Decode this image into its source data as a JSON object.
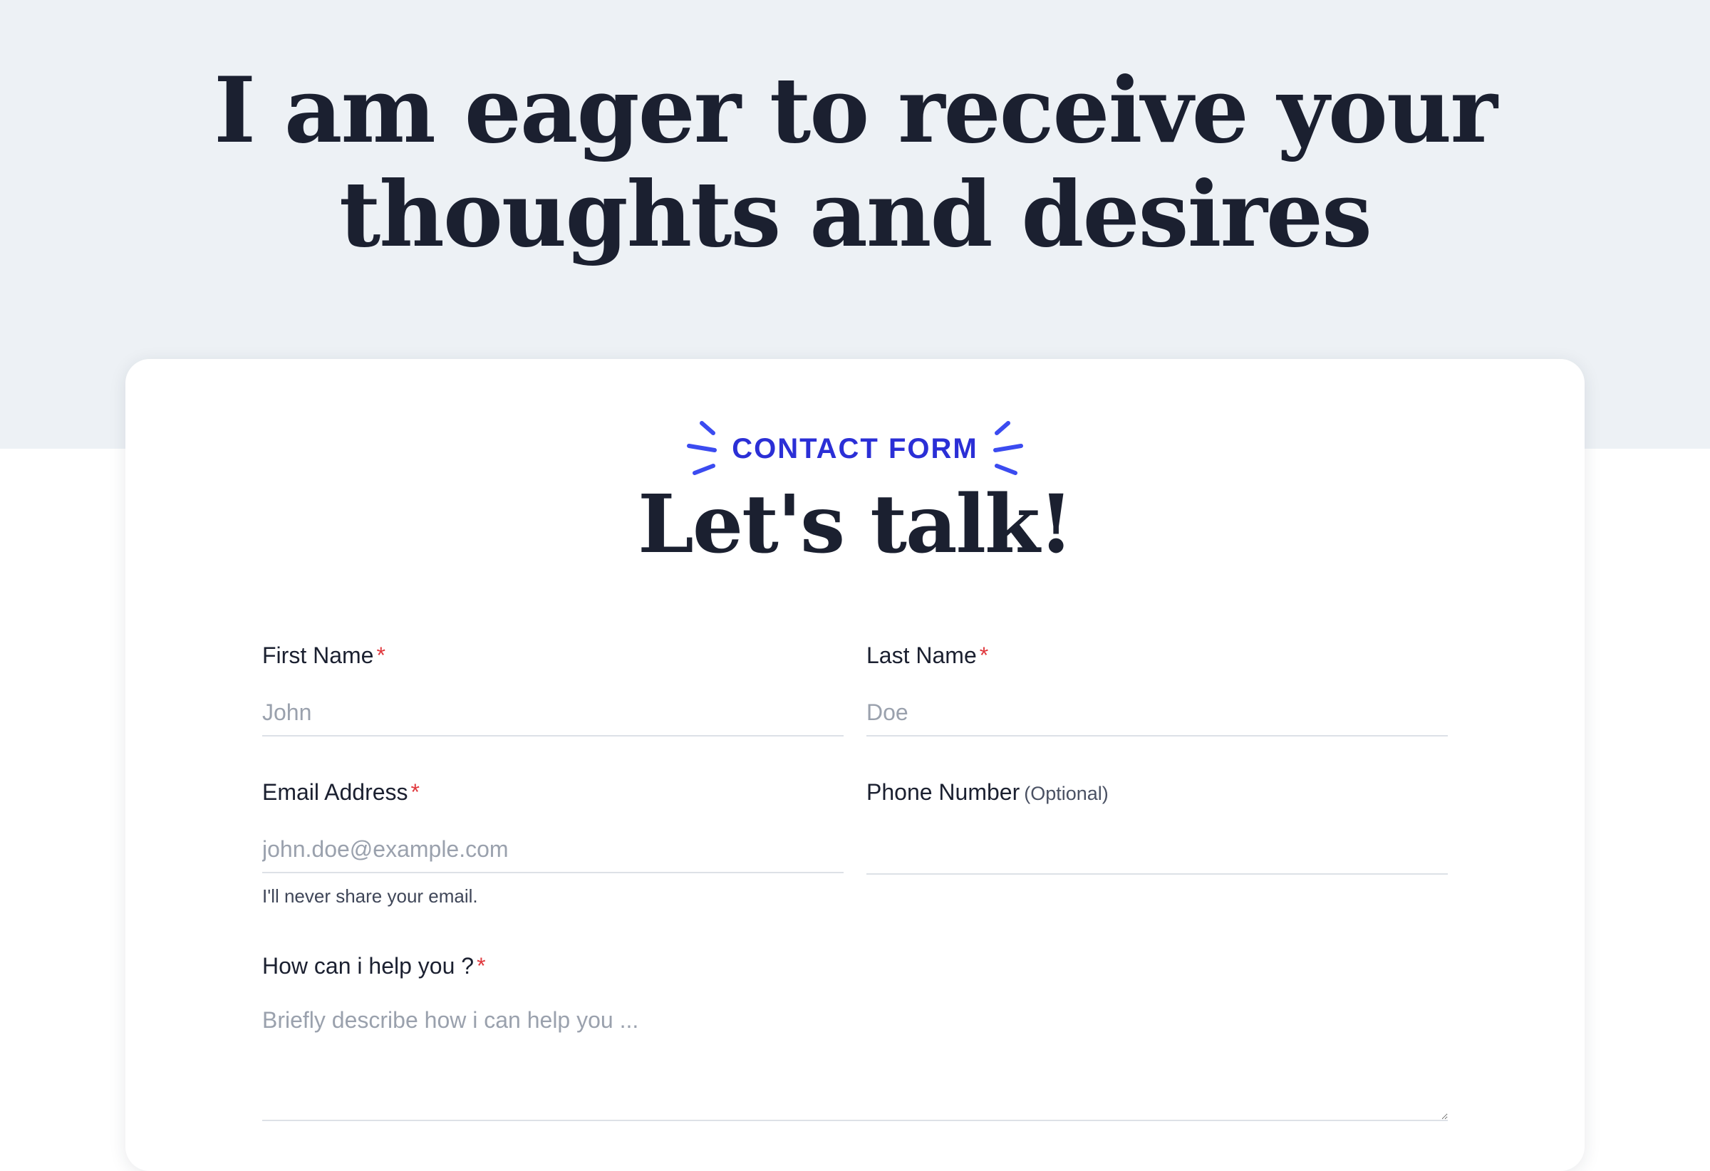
{
  "hero": {
    "title_line1": "I am eager to receive your",
    "title_line2": "thoughts and desires"
  },
  "form": {
    "eyebrow": "CONTACT FORM",
    "title": "Let's talk!",
    "required_marker": "*",
    "fields": {
      "first_name": {
        "label": "First Name",
        "placeholder": "John"
      },
      "last_name": {
        "label": "Last Name",
        "placeholder": "Doe"
      },
      "email": {
        "label": "Email Address",
        "placeholder": "john.doe@example.com",
        "help": "I'll never share your email."
      },
      "phone": {
        "label": "Phone Number",
        "optional": "(Optional)",
        "placeholder": ""
      },
      "message": {
        "label": "How can i help you ?",
        "placeholder": "Briefly describe how i can help you ..."
      }
    }
  },
  "colors": {
    "hero_bg": "#edf1f5",
    "accent": "#2b2fd6",
    "spark": "#3b4bf0",
    "required": "#e0393e",
    "text": "#1b2030"
  }
}
